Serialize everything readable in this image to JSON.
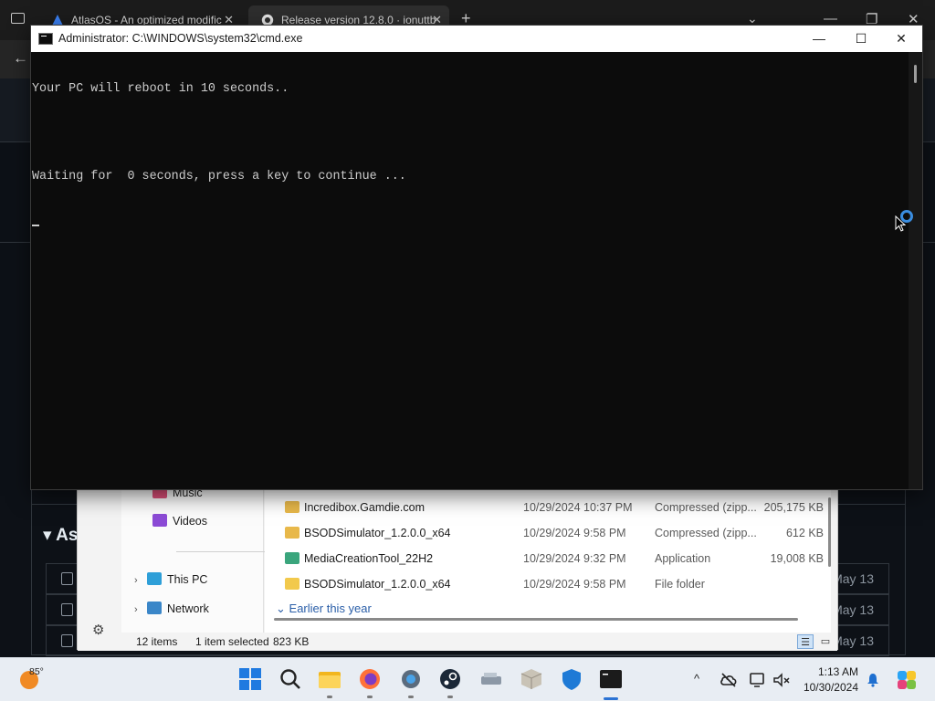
{
  "browser": {
    "tabs": [
      {
        "title": "AtlasOS - An optimized modific",
        "icon": "atlasos-logo-icon"
      },
      {
        "title": "Release version 12.8.0 · ionuttb",
        "icon": "github-icon"
      }
    ],
    "new_tab": "+",
    "tab_list": "⌄",
    "min": "—",
    "restore": "❐",
    "close": "✕",
    "back": "←"
  },
  "github": {
    "assets_heading": "▾ As",
    "rows": [
      {
        "date": "May 13"
      },
      {
        "date": "May 13"
      },
      {
        "date": "May 13"
      }
    ]
  },
  "cmd": {
    "title": "Administrator: C:\\WINDOWS\\system32\\cmd.exe",
    "lines": [
      "Your PC will reboot in 10 seconds..",
      "",
      "Waiting for  0 seconds, press a key to continue ..."
    ],
    "minimize": "—",
    "maximize": "☐",
    "close": "✕"
  },
  "explorer": {
    "nav": [
      {
        "label": "Music",
        "pinned": true
      },
      {
        "label": "Videos",
        "pinned": true
      },
      {
        "label": "This PC",
        "expand": "›"
      },
      {
        "label": "Network",
        "expand": "›"
      }
    ],
    "files": [
      {
        "name": "Incredibox.Gamdie.com",
        "date": "10/29/2024 10:37 PM",
        "type": "Compressed (zipp...",
        "size": "205,175 KB",
        "icon": "zip-folder-icon"
      },
      {
        "name": "BSODSimulator_1.2.0.0_x64",
        "date": "10/29/2024 9:58 PM",
        "type": "Compressed (zipp...",
        "size": "612 KB",
        "icon": "zip-folder-icon"
      },
      {
        "name": "MediaCreationTool_22H2",
        "date": "10/29/2024 9:32 PM",
        "type": "Application",
        "size": "19,008 KB",
        "icon": "application-icon"
      },
      {
        "name": "BSODSimulator_1.2.0.0_x64",
        "date": "10/29/2024 9:58 PM",
        "type": "File folder",
        "size": "",
        "icon": "folder-icon"
      }
    ],
    "group_label": "Earlier this year",
    "group_chevron": "⌄",
    "status": {
      "count": "12 items",
      "selected": "1 item selected",
      "size": "823 KB"
    }
  },
  "taskbar": {
    "temperature": "85°",
    "time": "1:13 AM",
    "date": "10/30/2024",
    "tray_chevron": "^",
    "apps": [
      "start-icon",
      "search-icon",
      "file-explorer-icon",
      "firefox-icon",
      "settings-icon",
      "steam-icon",
      "drive-icon",
      "package-icon",
      "defender-icon",
      "terminal-icon"
    ]
  }
}
